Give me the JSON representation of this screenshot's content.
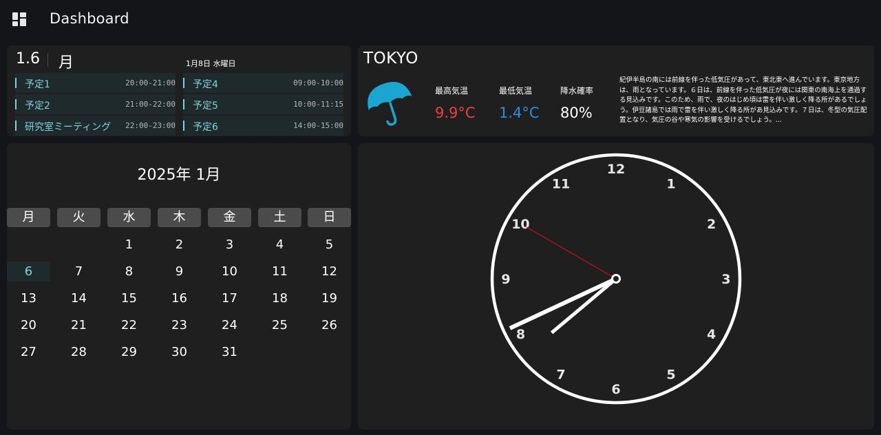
{
  "header": {
    "title": "Dashboard",
    "menu_icon": "grid-layout-icon"
  },
  "schedule": {
    "date": "1.6",
    "weekday": "月",
    "subtitle": "1月8日 水曜日",
    "left_events": [
      {
        "title": "予定1",
        "time": "20:00-21:00"
      },
      {
        "title": "予定2",
        "time": "21:00-22:00"
      },
      {
        "title": "研究室ミーティング",
        "time": "22:00-23:00"
      }
    ],
    "right_events": [
      {
        "title": "予定4",
        "time": "09:00-10:00"
      },
      {
        "title": "予定5",
        "time": "10:00-11:15"
      },
      {
        "title": "予定6",
        "time": "14:00-15:00"
      }
    ]
  },
  "weather": {
    "city": "TOKYO",
    "icon": "umbrella-icon",
    "high_label": "最高気温",
    "high_value": "9.9°C",
    "low_label": "最低気温",
    "low_value": "1.4°C",
    "rain_label": "降水確率",
    "rain_value": "80%",
    "forecast": "紀伊半島の南には前線を伴った低気圧があって、東北東へ進んでいます。東京地方は、雨となっています。６日は、前線を伴った低気圧が夜には関東の南海上を通過する見込みです。このため、雨で、夜のはじめ頃は雷を伴い激しく降る所があるでしょう。伊豆諸島では雨で雷を伴い激しく降る所があ見込みです。７日は、冬型の気圧配置となり、気圧の谷や寒気の影響を受けるでしょう。..."
  },
  "calendar": {
    "title": "2025年 1月",
    "weekdays": [
      "月",
      "火",
      "水",
      "木",
      "金",
      "土",
      "日"
    ],
    "first_weekday_index": 2,
    "days_in_month": 31,
    "today": 6
  },
  "clock": {
    "numbers": [
      "12",
      "1",
      "2",
      "3",
      "4",
      "5",
      "6",
      "7",
      "8",
      "9",
      "10",
      "11"
    ],
    "hour": 7,
    "minute": 40,
    "second": 50
  },
  "colors": {
    "accent": "#7fd3dd",
    "high_temp": "#f04141",
    "low_temp": "#2a8fe0",
    "second_hand": "#a01818",
    "umbrella": "#1aa6d0"
  }
}
